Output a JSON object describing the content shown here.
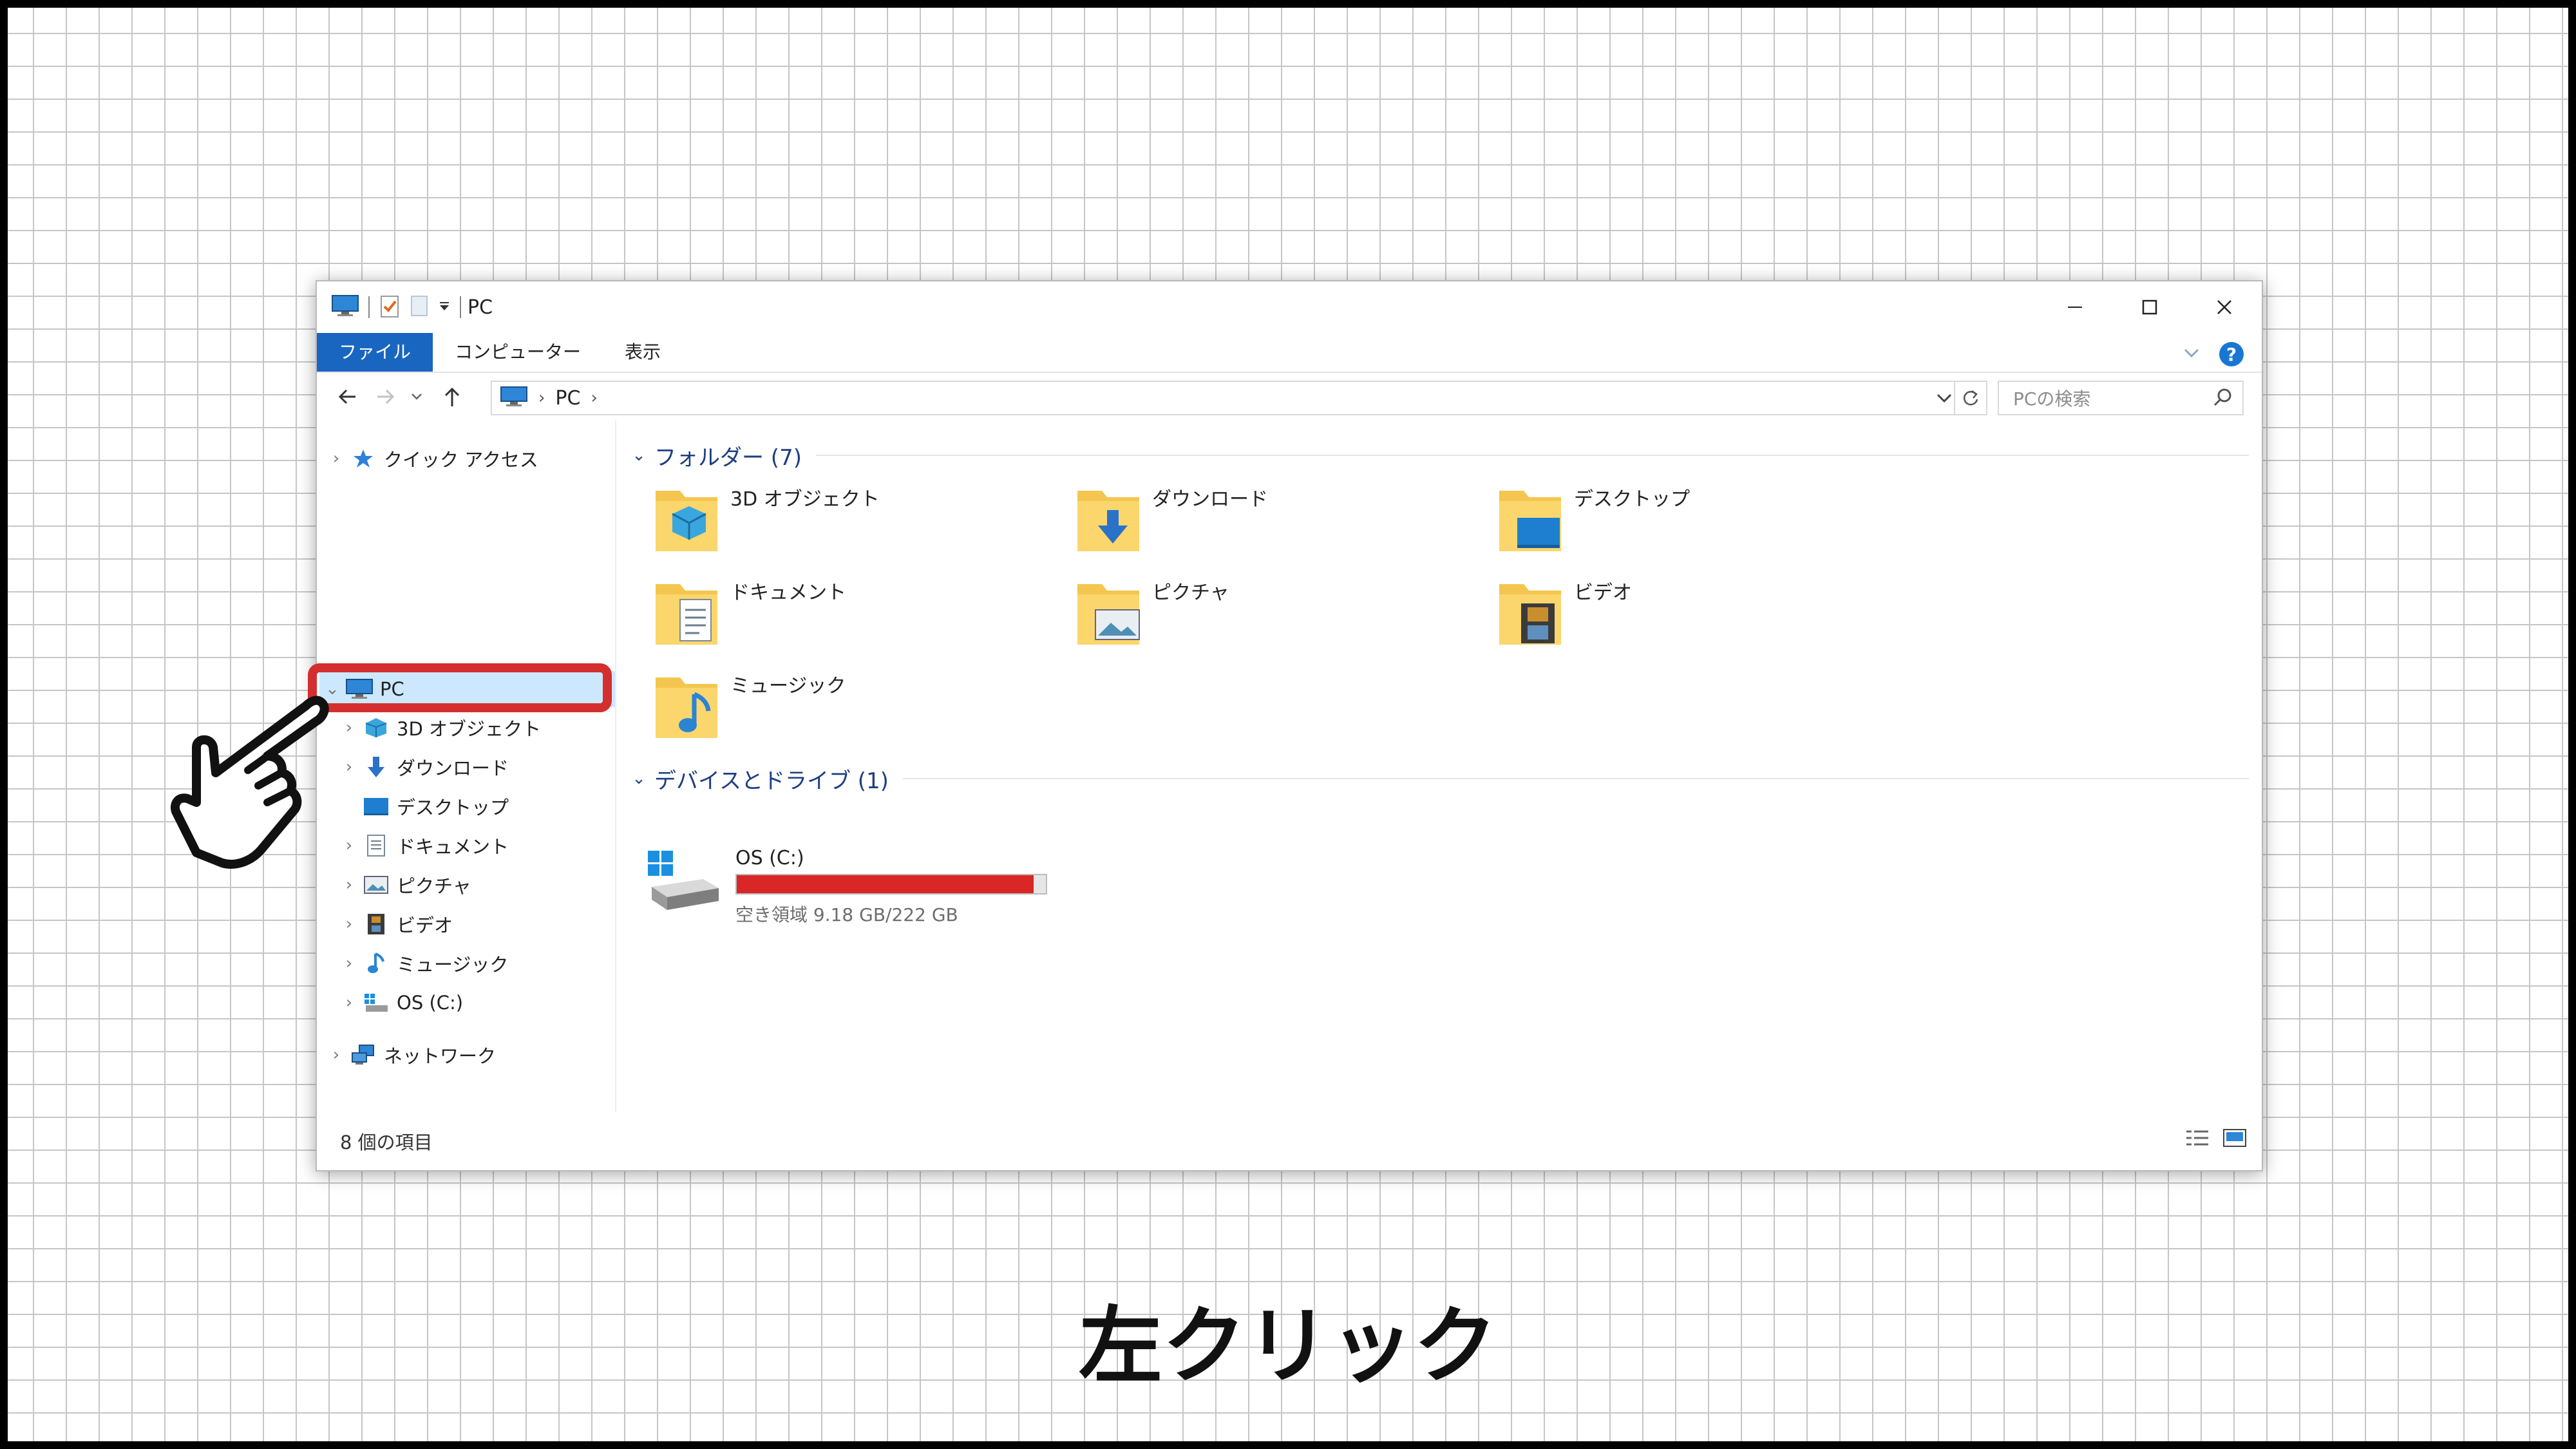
{
  "window": {
    "title": "PC",
    "ribbon_tabs": [
      "ファイル",
      "コンピューター",
      "表示"
    ],
    "help_label": "?"
  },
  "address": {
    "crumbs": [
      "PC"
    ],
    "search_placeholder": "PCの検索"
  },
  "nav": {
    "quick_access": "クイック アクセス",
    "pc": "PC",
    "pc_children": [
      "3D オブジェクト",
      "ダウンロード",
      "デスクトップ",
      "ドキュメント",
      "ピクチャ",
      "ビデオ",
      "ミュージック",
      "OS (C:)"
    ],
    "network": "ネットワーク"
  },
  "content": {
    "folders_group": "フォルダー (7)",
    "folders": [
      "3D オブジェクト",
      "ダウンロード",
      "デスクトップ",
      "ドキュメント",
      "ピクチャ",
      "ビデオ",
      "ミュージック"
    ],
    "devices_group": "デバイスとドライブ (1)",
    "drive": {
      "name": "OS (C:)",
      "free_text": "空き領域 9.18 GB/222 GB",
      "used_fraction": 0.96
    }
  },
  "status": {
    "item_count": "8 個の項目"
  },
  "caption": "左クリック",
  "colors": {
    "accent": "#1966c1",
    "highlight": "#d32f2f",
    "drive_bar": "#da2626",
    "selection": "#cce8ff"
  }
}
